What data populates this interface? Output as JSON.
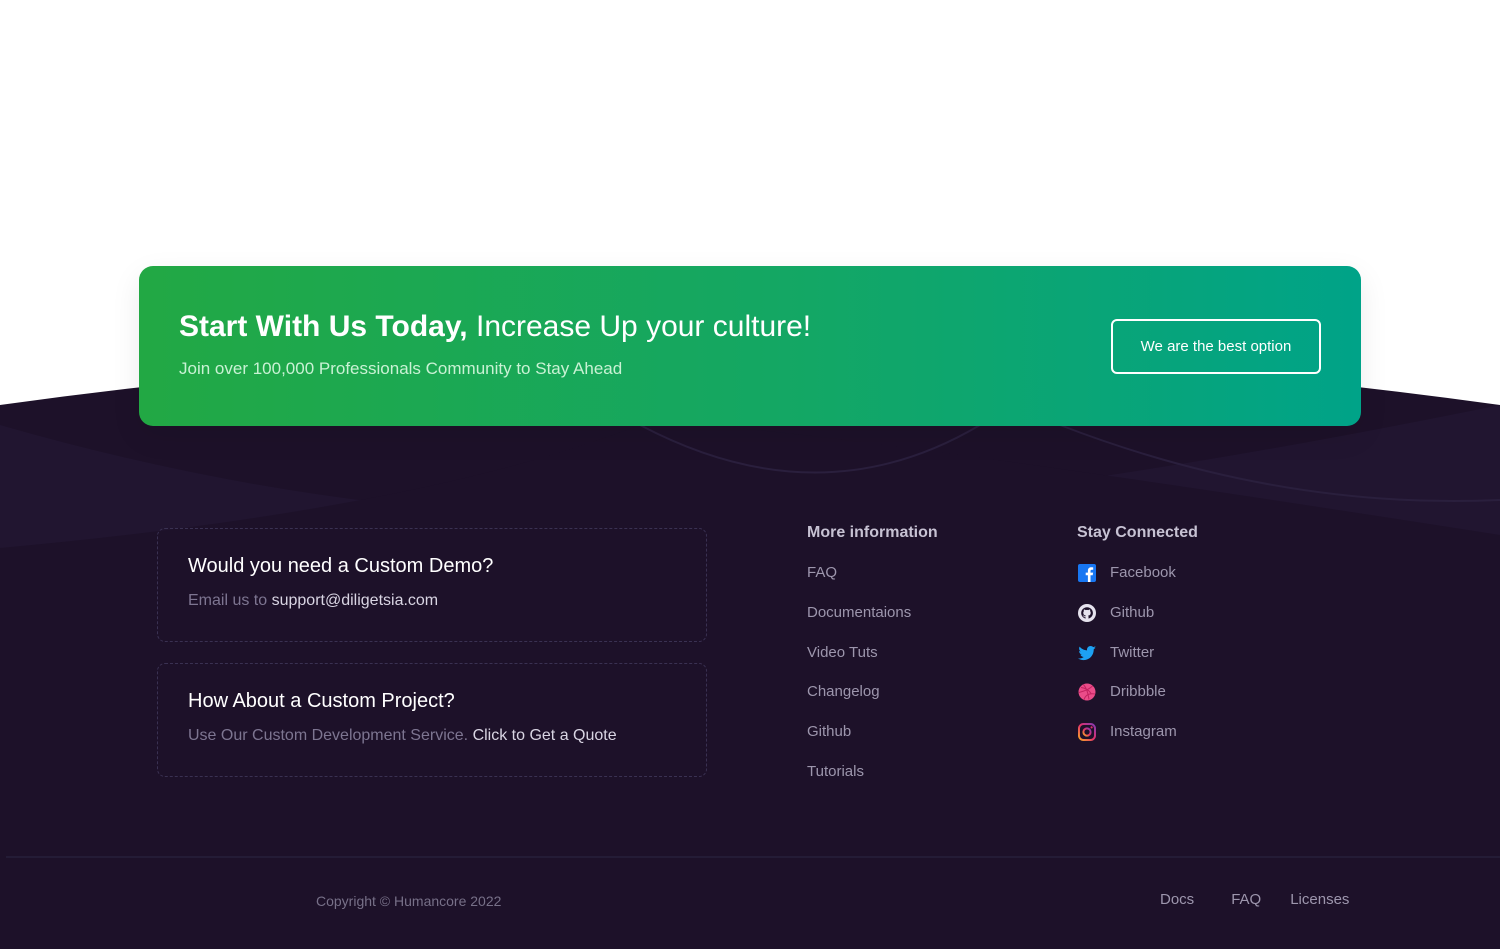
{
  "colors": {
    "page_background": "#ffffff",
    "footer_background": "#1d1129",
    "cta_gradient_start": "#22a844",
    "cta_gradient_end": "#00a388",
    "facebook": "#1877f2",
    "twitter": "#1da1f2",
    "dribbble": "#ea4c89",
    "instagram": "#e1306c"
  },
  "cta": {
    "title_bold": "Start With Us Today,",
    "title_rest": "Increase Up your culture!",
    "subtitle": "Join over 100,000 Professionals Community to Stay Ahead",
    "button_label": "We are the best option"
  },
  "cards": [
    {
      "title": "Would you need a Custom Demo?",
      "text": "Email us to",
      "link": "support@diligetsia.com"
    },
    {
      "title": "How About a Custom Project?",
      "text": "Use Our Custom Development Service.",
      "link": "Click to Get a Quote"
    }
  ],
  "more_info": {
    "title": "More information",
    "items": [
      "FAQ",
      "Documentaions",
      "Video Tuts",
      "Changelog",
      "Github",
      "Tutorials"
    ]
  },
  "stay_connected": {
    "title": "Stay Connected",
    "items": [
      {
        "label": "Facebook",
        "icon": "facebook-icon"
      },
      {
        "label": "Github",
        "icon": "github-icon"
      },
      {
        "label": "Twitter",
        "icon": "twitter-icon"
      },
      {
        "label": "Dribbble",
        "icon": "dribbble-icon"
      },
      {
        "label": "Instagram",
        "icon": "instagram-icon"
      }
    ]
  },
  "bottom_bar": {
    "copyright": "Copyright © Humancore 2022",
    "links": [
      "Docs",
      "FAQ",
      "Licenses"
    ]
  }
}
